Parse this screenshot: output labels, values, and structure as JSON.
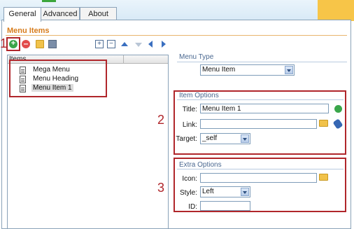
{
  "tabs": [
    {
      "label": "General",
      "active": true
    },
    {
      "label": "Advanced",
      "active": false
    },
    {
      "label": "About",
      "active": false
    }
  ],
  "section_title": "Menu Items",
  "toolbar": {
    "step_marker": "1",
    "icons": [
      "add-icon",
      "remove-icon",
      "add-folder-icon",
      "delete-icon",
      "expand-all-icon",
      "collapse-all-icon",
      "move-up-icon",
      "move-down-icon",
      "outdent-icon",
      "indent-icon"
    ]
  },
  "tree": {
    "header": "Items",
    "items": [
      {
        "label": "Mega Menu"
      },
      {
        "label": "Menu Heading"
      },
      {
        "label": "Menu Item 1",
        "selected": true
      }
    ]
  },
  "menu_type": {
    "label": "Menu Type",
    "selected": "Menu Item"
  },
  "item_options": {
    "title": "Item Options",
    "step_marker": "2",
    "title_label": "Title:",
    "title_value": "Menu Item 1",
    "link_label": "Link:",
    "link_value": "",
    "target_label": "Target:",
    "target_value": "_self"
  },
  "extra_options": {
    "title": "Extra Options",
    "step_marker": "3",
    "icon_label": "Icon:",
    "icon_value": "",
    "style_label": "Style:",
    "style_value": "Left",
    "id_label": "ID:",
    "id_value": ""
  },
  "colors": {
    "accent_orange": "#d77b1a",
    "annotation_red": "#b0262b",
    "border_blue": "#8aa2b8"
  }
}
